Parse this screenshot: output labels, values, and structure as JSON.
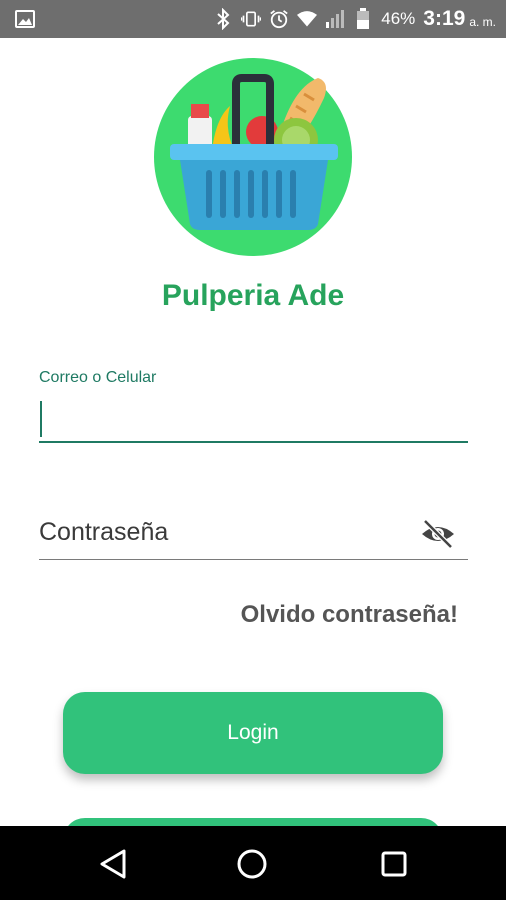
{
  "status_bar": {
    "battery": "46%",
    "time": "3:19",
    "ampm": "a. m.",
    "icons": [
      "image-icon",
      "bluetooth-icon",
      "vibrate-icon",
      "alarm-icon",
      "wifi-icon",
      "signal-icon",
      "battery-icon"
    ]
  },
  "app": {
    "title": "Pulperia Ade",
    "logo_icon": "grocery-basket-icon"
  },
  "form": {
    "email_label": "Correo o Celular",
    "email_value": "",
    "password_placeholder": "Contraseña",
    "password_toggle_icon": "eye-off-icon",
    "forgot_link": "Olvido contraseña!"
  },
  "buttons": {
    "login_label": "Login"
  },
  "colors": {
    "accent": "#31c27b",
    "title": "#27a35c",
    "field_focus": "#1f7a63",
    "status_bar": "#6e6e6e"
  },
  "nav": {
    "icons": [
      "back-icon",
      "home-icon",
      "recent-apps-icon"
    ]
  }
}
